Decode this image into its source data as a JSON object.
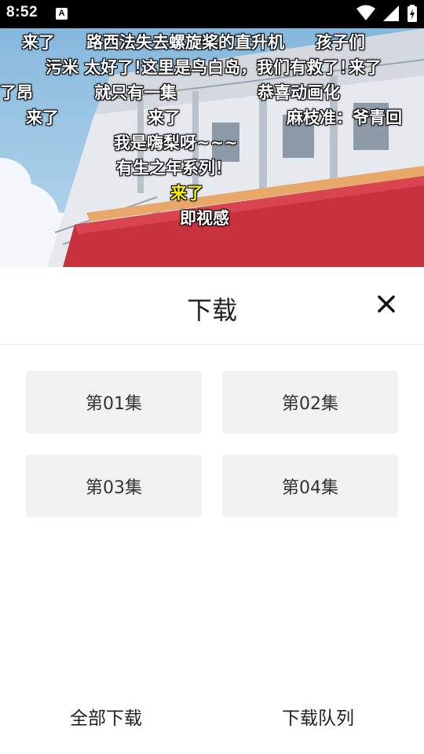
{
  "status_bar": {
    "time": "8:52",
    "notification_icon": "a-icon",
    "icons": [
      "wifi-icon",
      "signal-icon",
      "battery-icon"
    ]
  },
  "video": {
    "danmaku": [
      "来了",
      "路西法失去螺旋桨的直升机",
      "孩子们",
      "污米 太好了！",
      "这里是鸟白岛，我们有救了！",
      "来了",
      "了昂",
      "就只有一集",
      "恭喜动画化",
      "来了",
      "来了",
      "麻枝准：爷青回",
      "我是嗨梨呀~~~",
      "有生之年系列！",
      "来了",
      "即视感"
    ],
    "highlight_color": "#fff200"
  },
  "sheet": {
    "title": "下载",
    "episodes": [
      "第01集",
      "第02集",
      "第03集",
      "第04集"
    ],
    "download_all": "全部下载",
    "download_queue": "下载队列"
  },
  "colors": {
    "episode_bg": "#f2f2f2",
    "text": "#222222",
    "status_bar": "#000000"
  }
}
